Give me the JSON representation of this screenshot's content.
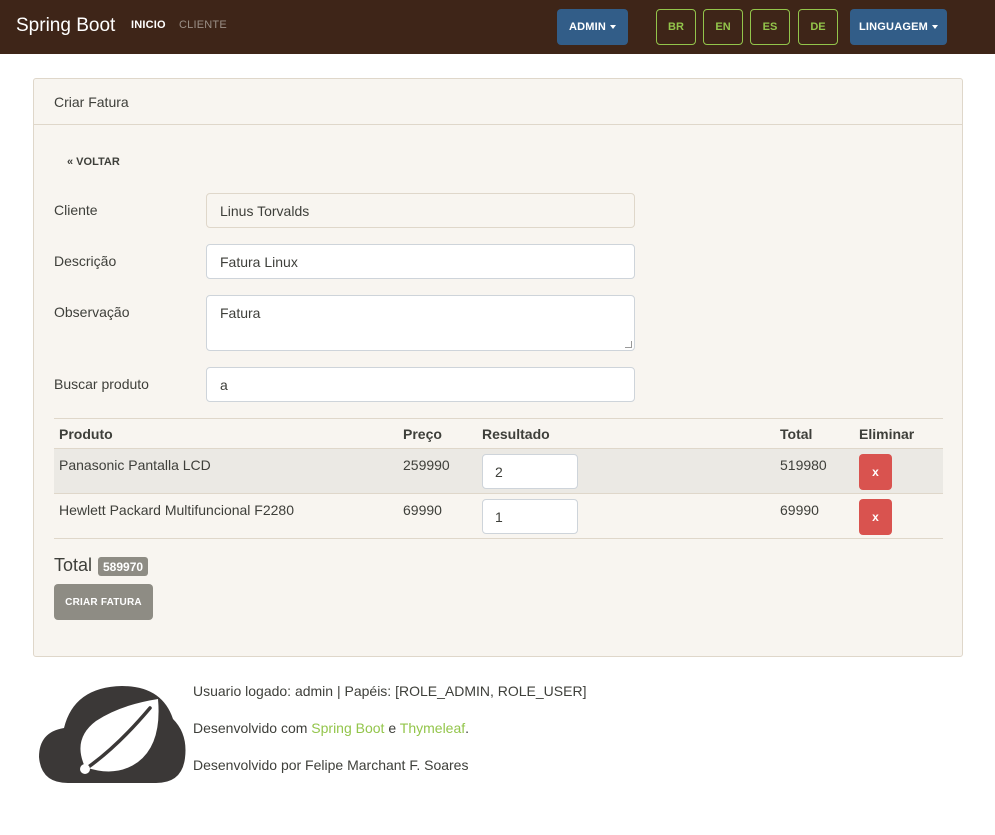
{
  "navbar": {
    "brand": "Spring Boot",
    "links": [
      "INICIO",
      "CLIENTE"
    ],
    "admin_label": "ADMIN",
    "languages": [
      "BR",
      "EN",
      "ES",
      "DE"
    ],
    "language_label": "LINGUAGEM"
  },
  "card": {
    "title": "Criar Fatura",
    "back_link": "« VOLTAR",
    "form": {
      "cliente": {
        "label": "Cliente",
        "value": "Linus Torvalds"
      },
      "descricao": {
        "label": "Descrição",
        "value": "Fatura Linux"
      },
      "observacao": {
        "label": "Observação",
        "value": "Fatura"
      },
      "buscar": {
        "label": "Buscar produto",
        "value": "a"
      }
    },
    "table": {
      "headers": [
        "Produto",
        "Preço",
        "Resultado",
        "Total",
        "Eliminar"
      ],
      "rows": [
        {
          "produto": "Panasonic Pantalla LCD",
          "preco": "259990",
          "quantidade": "2",
          "total": "519980",
          "eliminar": "x"
        },
        {
          "produto": "Hewlett Packard Multifuncional F2280",
          "preco": "69990",
          "quantidade": "1",
          "total": "69990",
          "eliminar": "x"
        }
      ]
    },
    "total_label": "Total",
    "total_value": "589970",
    "submit_label": "CRIAR FATURA"
  },
  "footer": {
    "logged_user": "Usuario logado: admin | Papéis: [ROLE_ADMIN, ROLE_USER]",
    "developed_with_prefix": "Desenvolvido com",
    "spring_boot_link": "Spring Boot",
    "and_word": "e",
    "thymeleaf_link": "Thymeleaf",
    "period": ".",
    "author": "Desenvolvido por Felipe Marchant F. Soares"
  },
  "colors": {
    "navbar_bg": "#3e2518",
    "primary": "#325d88",
    "success": "#93c54b",
    "danger": "#d9534f",
    "secondary": "#8e8c84",
    "card_bg": "#f8f5f0"
  },
  "icons": [
    "spring-leaf-logo-icon",
    "caret-down-icon"
  ]
}
